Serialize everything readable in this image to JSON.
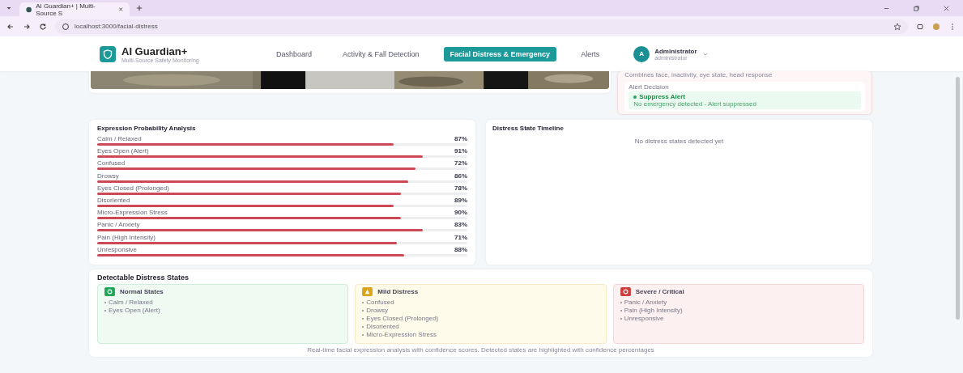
{
  "browser": {
    "tab_title": "AI Guardian+ | Multi-Source S",
    "url": "localhost:3000/facial-distress"
  },
  "header": {
    "app_name": "AI Guardian+",
    "subtitle": "Multi-Source Safety Monitoring",
    "nav": [
      {
        "label": "Dashboard",
        "selected": false
      },
      {
        "label": "Activity & Fall Detection",
        "selected": false
      },
      {
        "label": "Facial Distress & Emergency",
        "selected": true
      },
      {
        "label": "Alerts",
        "selected": false
      }
    ],
    "user": {
      "initial": "A",
      "name": "Administrator",
      "role": "administrator"
    }
  },
  "decision_panel": {
    "note": "Combines face, inactivity, eye state, head response",
    "label": "Alert Decision",
    "decision": "Suppress Alert",
    "detail": "No emergency detected - Alert suppressed"
  },
  "expressions": {
    "title": "Expression Probability Analysis",
    "rows": [
      {
        "name": "Calm / Relaxed",
        "value": "87%",
        "level": 0.8
      },
      {
        "name": "Eyes Open (Alert)",
        "value": "91%",
        "level": 0.88
      },
      {
        "name": "Confused",
        "value": "72%",
        "level": 0.86
      },
      {
        "name": "Drowsy",
        "value": "86%",
        "level": 0.84
      },
      {
        "name": "Eyes Closed (Prolonged)",
        "value": "78%",
        "level": 0.82
      },
      {
        "name": "Disoriented",
        "value": "89%",
        "level": 0.8
      },
      {
        "name": "Micro-Expression Stress",
        "value": "90%",
        "level": 0.82
      },
      {
        "name": "Panic / Anxiety",
        "value": "83%",
        "level": 0.88
      },
      {
        "name": "Pain (High Intensity)",
        "value": "71%",
        "level": 0.81
      },
      {
        "name": "Unresponsive",
        "value": "88%",
        "level": 0.83
      }
    ]
  },
  "timeline": {
    "title": "Distress State Timeline",
    "empty": "No distress states detected yet"
  },
  "states": {
    "title": "Detectable Distress States",
    "groups": [
      {
        "kind": "normal",
        "title": "Normal States",
        "items": [
          "Calm / Relaxed",
          "Eyes Open (Alert)"
        ]
      },
      {
        "kind": "mild",
        "title": "Mild Distress",
        "items": [
          "Confused",
          "Drowsy",
          "Eyes Closed (Prolonged)",
          "Disoriented",
          "Micro-Expression Stress"
        ]
      },
      {
        "kind": "severe",
        "title": "Severe / Critical",
        "items": [
          "Panic / Anxiety",
          "Pain (High Intensity)",
          "Unresponsive"
        ]
      }
    ],
    "footer": "Real-time facial expression analysis with confidence scores. Detected states are highlighted with confidence percentages"
  }
}
